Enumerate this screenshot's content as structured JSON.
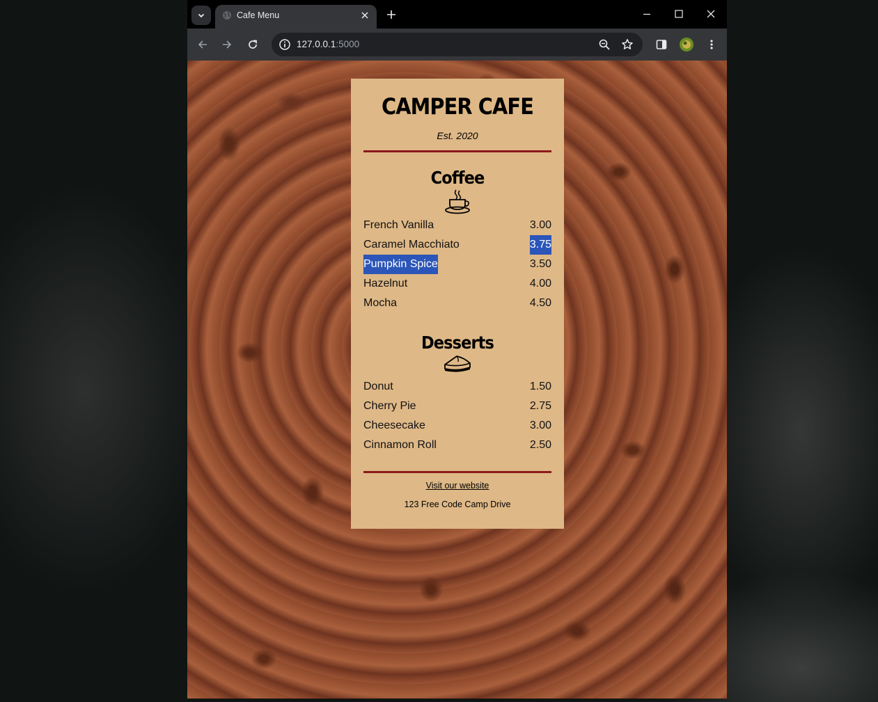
{
  "browser": {
    "tab_title": "Cafe Menu",
    "url_host": "127.0.0.1",
    "url_port": ":5000"
  },
  "menu": {
    "title": "CAMPER CAFE",
    "established": "Est. 2020",
    "coffee": {
      "heading": "Coffee",
      "icon": "coffee-cup-icon",
      "items": [
        {
          "name": "French Vanilla",
          "price": "3.00"
        },
        {
          "name": "Caramel Macchiato",
          "price": "3.75"
        },
        {
          "name": "Pumpkin Spice",
          "price": "3.50"
        },
        {
          "name": "Hazelnut",
          "price": "4.00"
        },
        {
          "name": "Mocha",
          "price": "4.50"
        }
      ]
    },
    "desserts": {
      "heading": "Desserts",
      "icon": "pie-slice-icon",
      "items": [
        {
          "name": "Donut",
          "price": "1.50"
        },
        {
          "name": "Cherry Pie",
          "price": "2.75"
        },
        {
          "name": "Cheesecake",
          "price": "3.00"
        },
        {
          "name": "Cinnamon Roll",
          "price": "2.50"
        }
      ]
    },
    "footer": {
      "link": "Visit our website",
      "address": "123 Free Code Camp Drive"
    }
  },
  "colors": {
    "menu_background": "#deb887",
    "divider": "#8b1a1a",
    "selection": "#2b55b8"
  }
}
